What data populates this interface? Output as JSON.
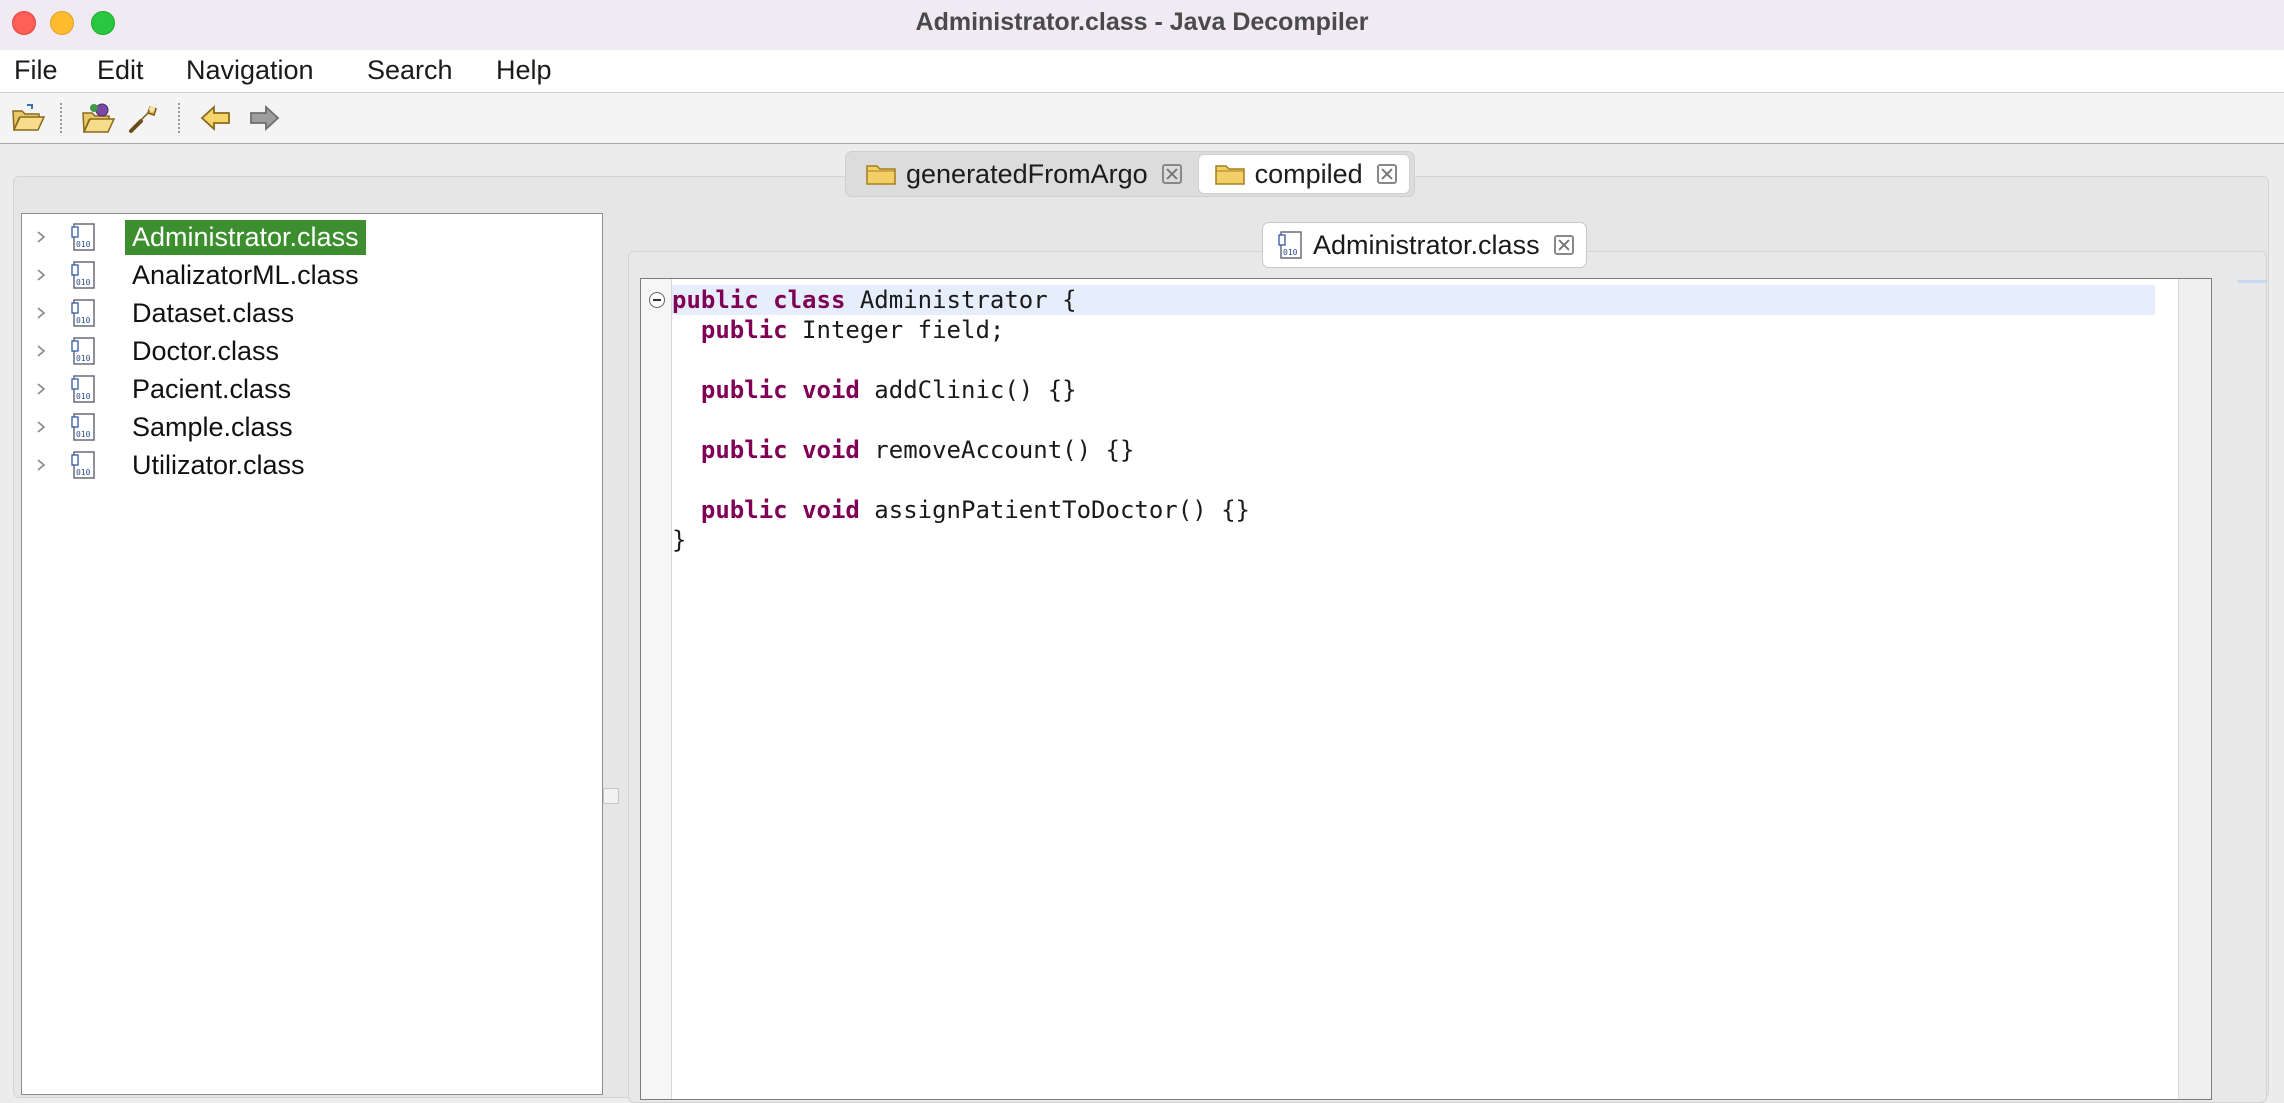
{
  "window": {
    "title": "Administrator.class - Java Decompiler"
  },
  "menubar": {
    "items": [
      "File",
      "Edit",
      "Navigation",
      "Search",
      "Help"
    ]
  },
  "toolbar": {
    "icons": [
      "open-file-icon",
      "open-type-icon",
      "search-icon",
      "back-icon",
      "forward-icon"
    ]
  },
  "workspace_tabs": [
    {
      "label": "generatedFromArgo",
      "active": false
    },
    {
      "label": "compiled",
      "active": true
    }
  ],
  "tree": {
    "items": [
      {
        "label": "Administrator.class",
        "selected": true
      },
      {
        "label": "AnalizatorML.class",
        "selected": false
      },
      {
        "label": "Dataset.class",
        "selected": false
      },
      {
        "label": "Doctor.class",
        "selected": false
      },
      {
        "label": "Pacient.class",
        "selected": false
      },
      {
        "label": "Sample.class",
        "selected": false
      },
      {
        "label": "Utilizator.class",
        "selected": false
      }
    ]
  },
  "editor": {
    "tab_label": "Administrator.class",
    "code_lines": [
      [
        {
          "t": "public",
          "k": true
        },
        {
          "t": " "
        },
        {
          "t": "class",
          "k": true
        },
        {
          "t": " Administrator {"
        }
      ],
      [
        {
          "t": "  "
        },
        {
          "t": "public",
          "k": true
        },
        {
          "t": " Integer field;"
        }
      ],
      [],
      [
        {
          "t": "  "
        },
        {
          "t": "public",
          "k": true
        },
        {
          "t": " "
        },
        {
          "t": "void",
          "k": true
        },
        {
          "t": " addClinic() {}"
        }
      ],
      [],
      [
        {
          "t": "  "
        },
        {
          "t": "public",
          "k": true
        },
        {
          "t": " "
        },
        {
          "t": "void",
          "k": true
        },
        {
          "t": " removeAccount() {}"
        }
      ],
      [],
      [
        {
          "t": "  "
        },
        {
          "t": "public",
          "k": true
        },
        {
          "t": " "
        },
        {
          "t": "void",
          "k": true
        },
        {
          "t": " assignPatientToDoctor() {}"
        }
      ],
      [
        {
          "t": "}"
        }
      ]
    ]
  },
  "colors": {
    "selection": "#3c8e2e",
    "keyword": "#7f0055",
    "current_line": "#e6eefc"
  }
}
